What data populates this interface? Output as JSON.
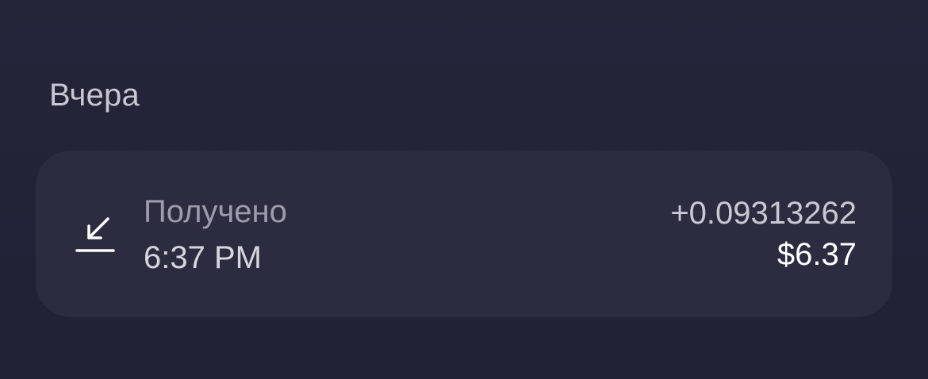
{
  "section": {
    "date_label": "Вчера"
  },
  "transaction": {
    "icon": "receive-arrow-icon",
    "type_label": "Получено",
    "time": "6:37 PM",
    "crypto_amount": "+0.09313262",
    "fiat_amount": "$6.37"
  },
  "colors": {
    "background": "#23233a",
    "card": "#2c2c41",
    "primary_text": "#ffffff",
    "secondary_text": "#9c9cab"
  }
}
